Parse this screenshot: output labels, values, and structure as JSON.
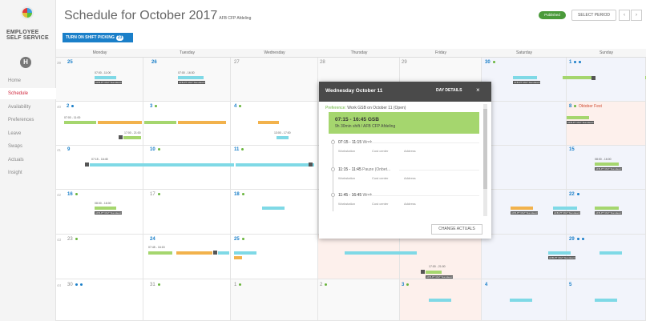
{
  "sidebar": {
    "brand": "EMPLOYEE SELF SERVICE",
    "avatar_initial": "H",
    "items": [
      {
        "label": "Home"
      },
      {
        "label": "Schedule"
      },
      {
        "label": "Availability"
      },
      {
        "label": "Preferences"
      },
      {
        "label": "Leave"
      },
      {
        "label": "Swaps"
      },
      {
        "label": "Actuals"
      },
      {
        "label": "Insight"
      }
    ]
  },
  "header": {
    "title": "Schedule for October 2017",
    "subtitle": "AFB CFP Afdeling",
    "status": "Published",
    "select_period": "SELECT PERIOD",
    "prev": "‹",
    "next": "›",
    "shift_picking_label": "TURN ON SHIFT PICKING",
    "shift_picking_count": "23"
  },
  "calendar": {
    "days": [
      "Monday",
      "Tuesday",
      "Wednesday",
      "Thursday",
      "Friday",
      "Saturday",
      "Sunday"
    ],
    "weeks": [
      "39",
      "40",
      "41",
      "42",
      "43",
      "44"
    ],
    "dates": [
      [
        "25",
        "26",
        "27",
        "28",
        "29",
        "30",
        "1"
      ],
      [
        "2",
        "3",
        "4",
        "5",
        "6",
        "7",
        "8"
      ],
      [
        "9",
        "10",
        "11",
        "12",
        "13",
        "14",
        "15"
      ],
      [
        "16",
        "17",
        "18",
        "19",
        "20",
        "21",
        "22"
      ],
      [
        "23",
        "24",
        "25",
        "26",
        "27",
        "28",
        "29"
      ],
      [
        "30",
        "31",
        "1",
        "2",
        "3",
        "4",
        "5"
      ]
    ],
    "holiday_name": "Oktober Fest",
    "tag_label": "AFB-PT RGT Standaard",
    "shift_code": "GCB",
    "entries": [
      {
        "time": "07:00 - 11:00",
        "code": "GCB"
      },
      {
        "time": "07:00 - 16:30",
        "code": "GCB"
      },
      {
        "time": "07:15 - 16:45",
        "code": "GCB"
      },
      {
        "time": "07:45 - 16:15",
        "code": "GCB"
      },
      {
        "time": "17:00 - 21:00",
        "code": "GCB"
      },
      {
        "time": "13:00 - 17:00",
        "code": "LB"
      },
      {
        "time": "08:00 - 16:00",
        "code": "HCB"
      }
    ]
  },
  "popup": {
    "title": "Wednesday October 11",
    "day_details": "DAY DETAILS",
    "close": "×",
    "preference_key": "Preference:",
    "preference_text": "Work GSB on October 11 (Open)",
    "main_time": "07:15 - 16:45 GSB",
    "main_sub": "9h 30min shift / AFB CFP Afdeling",
    "entries": [
      {
        "time": "07:15 - 11:15",
        "type": "Work",
        "c1": "Workstation",
        "c2": "Cost center",
        "c3": "Address"
      },
      {
        "time": "11:15 - 11:45",
        "type": "Pauze (Onbet...",
        "c1": "Workstation",
        "c2": "Cost center",
        "c3": "Address"
      },
      {
        "time": "11:45 - 16:45",
        "type": "Work",
        "c1": "Workstation",
        "c2": "Cost center",
        "c3": "Address"
      }
    ],
    "change_actuals": "CHANGE ACTUALS"
  },
  "colors": {
    "brand_blue": "#1a7fc9",
    "active_red": "#d0273d",
    "published_green": "#4a9a3a",
    "shift_green": "#a5d66e",
    "shift_orange": "#f2b24c",
    "shift_cyan": "#7fd9e6"
  }
}
